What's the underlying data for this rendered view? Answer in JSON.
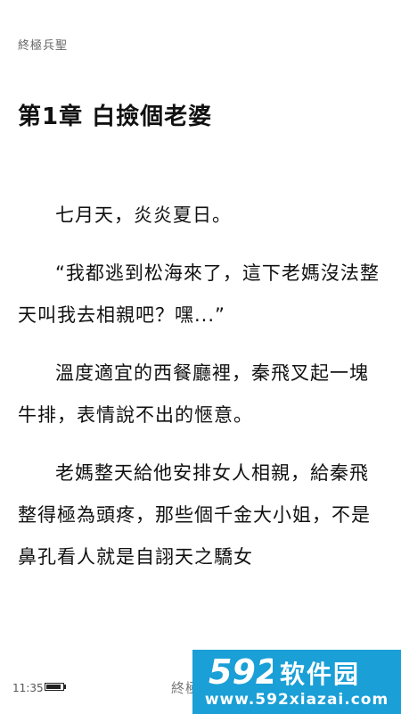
{
  "header": {
    "book_name": "終極兵聖"
  },
  "chapter": {
    "title": "第1章 白撿個老婆"
  },
  "paragraphs": [
    "七月天，炎炎夏日。",
    "“我都逃到松海來了，這下老媽沒法整天叫我去相親吧？嘿...”",
    "溫度適宜的西餐廳裡，秦飛叉起一塊牛排，表情說不出的愜意。",
    "老媽整天給他安排女人相親，給秦飛整得極為頭疼，那些個千金大小姐，不是鼻孔看人就是自詡天之驕女"
  ],
  "footer": {
    "time": "11:35",
    "book_name": "終極",
    "battery_level": 0.9
  },
  "watermark": {
    "logo_text": "592",
    "cn_text": "软件园",
    "url": "www.592xiazai.com",
    "color": "#1a9fd6"
  }
}
